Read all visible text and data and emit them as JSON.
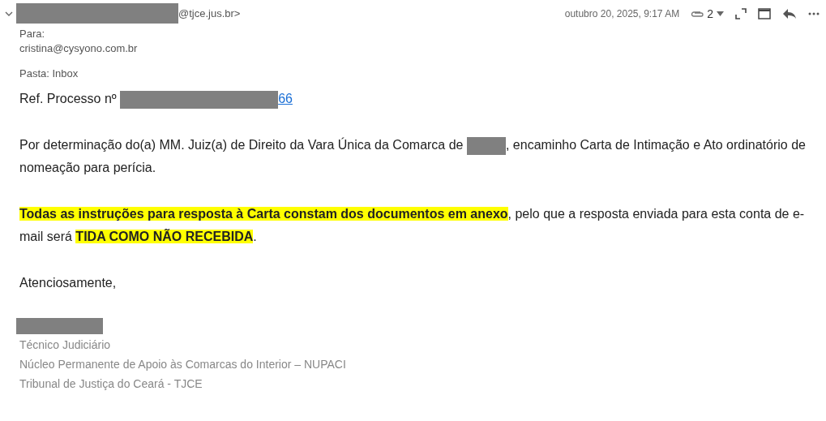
{
  "header": {
    "sender": [
      {
        "kind": "redacted"
      },
      {
        "kind": "text",
        "text": "@tjce.jus.br>"
      }
    ],
    "date": "outubro 20, 2025, 9:17 AM",
    "attachments": "2",
    "to_label": "Para:",
    "to": "cristina@cysyono.com.br",
    "folder": "Pasta: Inbox"
  },
  "body": [
    [
      {
        "kind": "text",
        "text": "Ref. Processo nº "
      },
      {
        "kind": "redacted"
      },
      {
        "kind": "link",
        "text": "66"
      }
    ],
    [
      {
        "kind": "text",
        "text": "Por determinação do(a) MM. Juiz(a) de Direito da Vara Única da Comarca de "
      },
      {
        "kind": "redacted"
      },
      {
        "kind": "text",
        "text": ", encaminho Carta de Intimação e Ato ordinatório de nomeação para perícia."
      }
    ],
    [
      {
        "kind": "highlight",
        "text": "Todas as instruções para resposta à Carta constam dos documentos em anexo"
      },
      {
        "kind": "text",
        "text": ", pelo que a resposta enviada para esta conta de e-mail será "
      },
      {
        "kind": "highlight",
        "text": "TIDA COMO NÃO RECEBIDA"
      },
      {
        "kind": "text",
        "text": "."
      }
    ],
    [
      {
        "kind": "text",
        "text": "Atenciosamente,"
      }
    ]
  ],
  "signature": [
    {
      "kind": "redacted"
    },
    {
      "kind": "text",
      "text": "Técnico Judiciário"
    },
    {
      "kind": "text",
      "text": "Núcleo Permanente de Apoio às Comarcas do Interior – NUPACI"
    },
    {
      "kind": "text",
      "text": "Tribunal de Justiça do Ceará - TJCE"
    }
  ]
}
